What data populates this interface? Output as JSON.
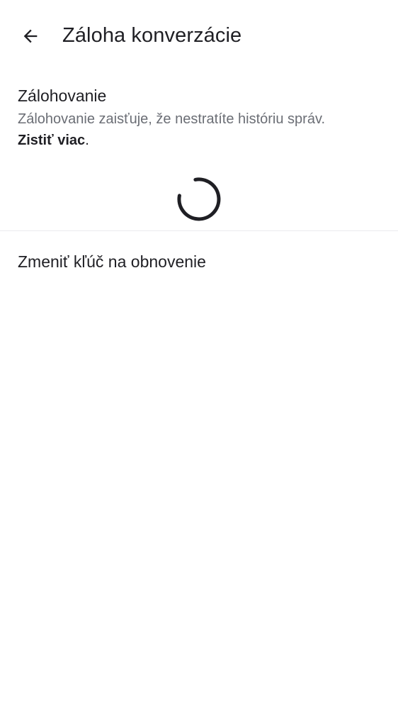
{
  "header": {
    "back_icon": "arrow-left-icon",
    "title": "Záloha konverzácie"
  },
  "backup": {
    "title": "Zálohovanie",
    "description": "Zálohovanie zaisťuje, že nestratíte históriu správ.",
    "learn_more": "Zistiť viac",
    "learn_more_suffix": "."
  },
  "spinner": {
    "icon": "loading-spinner-icon",
    "color": "#1f1f24"
  },
  "recovery": {
    "label": "Zmeniť kľúč na obnovenie"
  },
  "colors": {
    "text_primary": "#1f1f24",
    "text_secondary": "#6b6e75",
    "divider": "#ebebee",
    "background": "#ffffff"
  }
}
